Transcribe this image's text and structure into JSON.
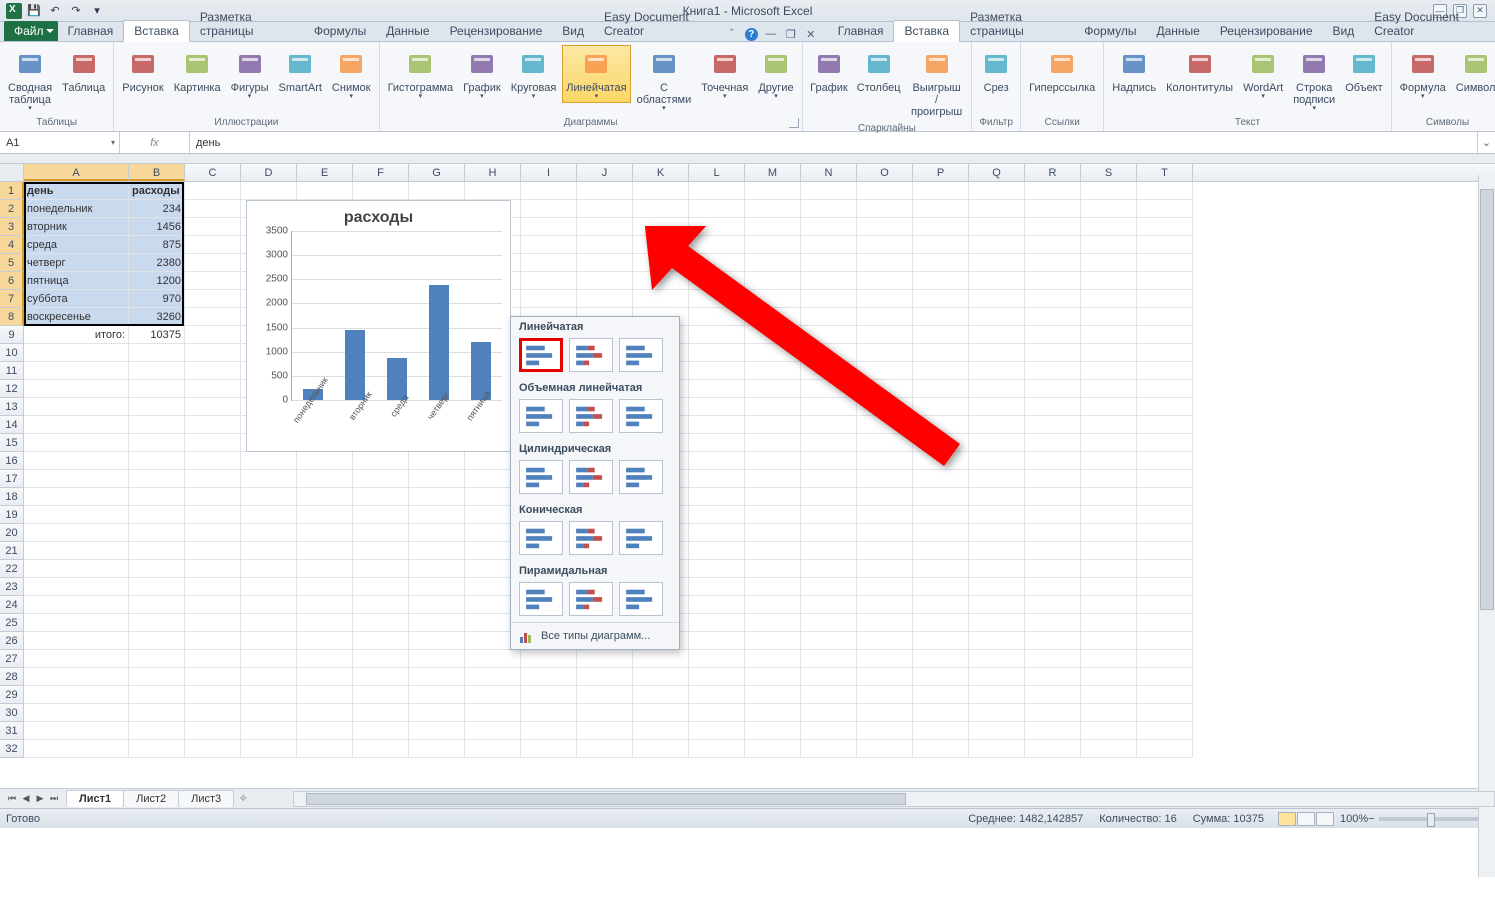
{
  "title": "Книга1 - Microsoft Excel",
  "tabs": {
    "file": "Файл",
    "items": [
      "Главная",
      "Вставка",
      "Разметка страницы",
      "Формулы",
      "Данные",
      "Рецензирование",
      "Вид",
      "Easy Document Creator"
    ],
    "active_index": 1
  },
  "ribbon": {
    "groups": [
      {
        "name": "Таблицы",
        "items": [
          {
            "label": "Сводная\nтаблица",
            "dd": true
          },
          {
            "label": "Таблица"
          }
        ]
      },
      {
        "name": "Иллюстрации",
        "items": [
          {
            "label": "Рисунок"
          },
          {
            "label": "Картинка"
          },
          {
            "label": "Фигуры",
            "dd": true
          },
          {
            "label": "SmartArt"
          },
          {
            "label": "Снимок",
            "dd": true
          }
        ]
      },
      {
        "name": "Диаграммы",
        "launcher": true,
        "items": [
          {
            "label": "Гистограмма",
            "dd": true
          },
          {
            "label": "График",
            "dd": true
          },
          {
            "label": "Круговая",
            "dd": true
          },
          {
            "label": "Линейчатая",
            "dd": true,
            "active": true
          },
          {
            "label": "С\nобластями",
            "dd": true
          },
          {
            "label": "Точечная",
            "dd": true
          },
          {
            "label": "Другие",
            "dd": true
          }
        ]
      },
      {
        "name": "Спарклайны",
        "items": [
          {
            "label": "График"
          },
          {
            "label": "Столбец"
          },
          {
            "label": "Выигрыш /\nпроигрыш"
          }
        ]
      },
      {
        "name": "Фильтр",
        "items": [
          {
            "label": "Срез"
          }
        ]
      },
      {
        "name": "Ссылки",
        "items": [
          {
            "label": "Гиперссылка"
          }
        ]
      },
      {
        "name": "Текст",
        "items": [
          {
            "label": "Надпись"
          },
          {
            "label": "Колонтитулы"
          },
          {
            "label": "WordArt",
            "dd": true
          },
          {
            "label": "Строка\nподписи",
            "dd": true
          },
          {
            "label": "Объект"
          }
        ]
      },
      {
        "name": "Символы",
        "items": [
          {
            "label": "Формула",
            "dd": true
          },
          {
            "label": "Символ"
          }
        ]
      }
    ]
  },
  "name_box": "A1",
  "formula": "день",
  "dropdown": {
    "sections": [
      "Линейчатая",
      "Объемная линейчатая",
      "Цилиндрическая",
      "Коническая",
      "Пирамидальная"
    ],
    "footer": "Все типы диаграмм..."
  },
  "columns": [
    "A",
    "B",
    "C",
    "D",
    "E",
    "F",
    "G",
    "H",
    "I",
    "J",
    "K",
    "L",
    "M",
    "N",
    "O",
    "P",
    "Q",
    "R",
    "S",
    "T"
  ],
  "sheet": {
    "headers": [
      "день",
      "расходы"
    ],
    "rows": [
      [
        "понедельник",
        "234"
      ],
      [
        "вторник",
        "1456"
      ],
      [
        "среда",
        "875"
      ],
      [
        "четверг",
        "2380"
      ],
      [
        "пятница",
        "1200"
      ],
      [
        "суббота",
        "970"
      ],
      [
        "воскресенье",
        "3260"
      ]
    ],
    "total_label": "итого:",
    "total_value": "10375"
  },
  "chart_data": {
    "type": "bar",
    "title": "расходы",
    "categories": [
      "понедельник",
      "вторник",
      "среда",
      "четверг",
      "пятница"
    ],
    "values": [
      234,
      1456,
      875,
      2380,
      1200
    ],
    "ylim": [
      0,
      3500
    ],
    "ystep": 500,
    "xlabel": "",
    "ylabel": ""
  },
  "sheet_tabs": [
    "Лист1",
    "Лист2",
    "Лист3"
  ],
  "status": {
    "ready": "Готово",
    "avg_label": "Среднее:",
    "avg": "1482,142857",
    "count_label": "Количество:",
    "count": "16",
    "sum_label": "Сумма:",
    "sum": "10375",
    "zoom": "100%"
  }
}
